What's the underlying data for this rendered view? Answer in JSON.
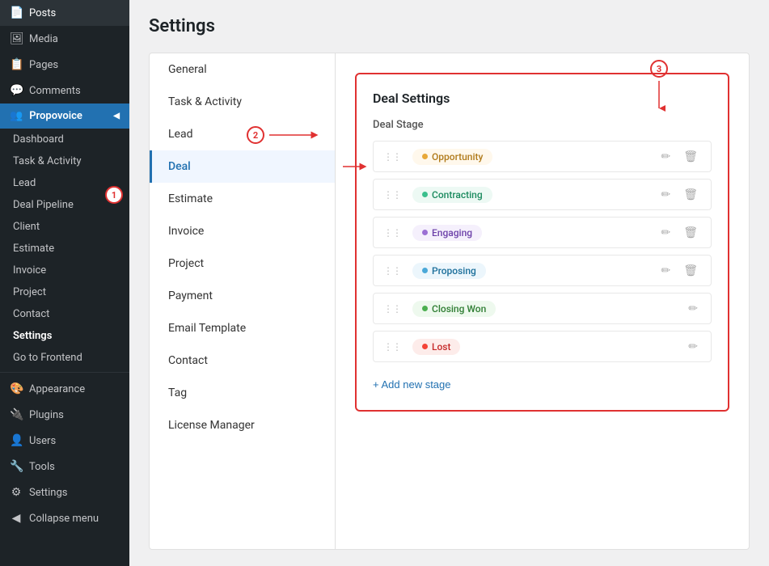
{
  "sidebar": {
    "menu_items": [
      {
        "id": "posts",
        "label": "Posts",
        "icon": "📄"
      },
      {
        "id": "media",
        "label": "Media",
        "icon": "🖼"
      },
      {
        "id": "pages",
        "label": "Pages",
        "icon": "📋"
      },
      {
        "id": "comments",
        "label": "Comments",
        "icon": "💬"
      }
    ],
    "propovoice_label": "Propovoice",
    "sub_items": [
      {
        "id": "dashboard",
        "label": "Dashboard",
        "active": false
      },
      {
        "id": "task-activity",
        "label": "Task & Activity",
        "active": false
      },
      {
        "id": "lead",
        "label": "Lead",
        "active": false
      },
      {
        "id": "deal-pipeline",
        "label": "Deal Pipeline",
        "active": false
      },
      {
        "id": "client",
        "label": "Client",
        "active": false
      },
      {
        "id": "estimate",
        "label": "Estimate",
        "active": false
      },
      {
        "id": "invoice",
        "label": "Invoice",
        "active": false
      },
      {
        "id": "project",
        "label": "Project",
        "active": false
      },
      {
        "id": "contact",
        "label": "Contact",
        "active": false
      },
      {
        "id": "settings",
        "label": "Settings",
        "active": true
      },
      {
        "id": "go-to-frontend",
        "label": "Go to Frontend",
        "active": false
      }
    ],
    "bottom_items": [
      {
        "id": "appearance",
        "label": "Appearance",
        "icon": "🎨"
      },
      {
        "id": "plugins",
        "label": "Plugins",
        "icon": "🔌"
      },
      {
        "id": "users",
        "label": "Users",
        "icon": "👤"
      },
      {
        "id": "tools",
        "label": "Tools",
        "icon": "🔧"
      },
      {
        "id": "settings",
        "label": "Settings",
        "icon": "⚙"
      },
      {
        "id": "collapse",
        "label": "Collapse menu",
        "icon": "◀"
      }
    ]
  },
  "page": {
    "title": "Settings"
  },
  "settings_nav": {
    "items": [
      {
        "id": "general",
        "label": "General",
        "active": false
      },
      {
        "id": "task-activity",
        "label": "Task & Activity",
        "active": false
      },
      {
        "id": "lead",
        "label": "Lead",
        "active": false
      },
      {
        "id": "deal",
        "label": "Deal",
        "active": true
      },
      {
        "id": "estimate",
        "label": "Estimate",
        "active": false
      },
      {
        "id": "invoice",
        "label": "Invoice",
        "active": false
      },
      {
        "id": "project",
        "label": "Project",
        "active": false
      },
      {
        "id": "payment",
        "label": "Payment",
        "active": false
      },
      {
        "id": "email-template",
        "label": "Email Template",
        "active": false
      },
      {
        "id": "contact",
        "label": "Contact",
        "active": false
      },
      {
        "id": "tag",
        "label": "Tag",
        "active": false
      },
      {
        "id": "license-manager",
        "label": "License Manager",
        "active": false
      }
    ]
  },
  "deal_settings": {
    "panel_title": "Deal Settings",
    "section_label": "Deal Stage",
    "stages": [
      {
        "id": "opportunity",
        "label": "Opportunity",
        "dot_color": "#e8a838",
        "bg_color": "#fff8ec",
        "text_color": "#b07a1a",
        "has_delete": true
      },
      {
        "id": "contracting",
        "label": "Contracting",
        "dot_color": "#3bbf8d",
        "bg_color": "#edf9f4",
        "text_color": "#1a8a5e",
        "has_delete": true
      },
      {
        "id": "engaging",
        "label": "Engaging",
        "dot_color": "#9b6fd4",
        "bg_color": "#f5f0fc",
        "text_color": "#6b3fa8",
        "has_delete": true
      },
      {
        "id": "proposing",
        "label": "Proposing",
        "dot_color": "#4aa8d8",
        "bg_color": "#ecf6fc",
        "text_color": "#1a6e9a",
        "has_delete": true
      },
      {
        "id": "closing-won",
        "label": "Closing Won",
        "dot_color": "#4caf50",
        "bg_color": "#eef9ee",
        "text_color": "#2e7d32",
        "has_delete": false
      },
      {
        "id": "lost",
        "label": "Lost",
        "dot_color": "#f44336",
        "bg_color": "#fdecea",
        "text_color": "#c62828",
        "has_delete": false
      }
    ],
    "add_stage_label": "+ Add new stage"
  },
  "annotations": {
    "one": "1",
    "two": "2",
    "three": "3"
  }
}
